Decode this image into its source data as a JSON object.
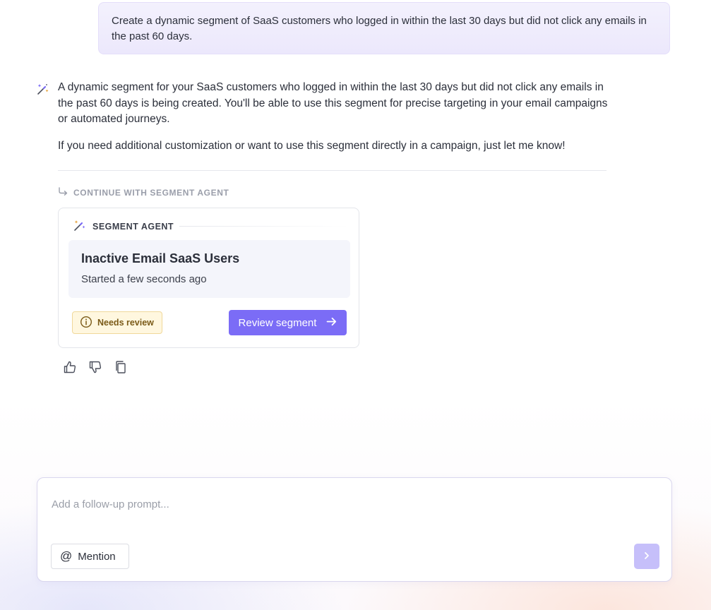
{
  "user_message": "Create a dynamic segment of SaaS customers who logged in within the last 30 days but did not click any emails in the past 60 days.",
  "assistant": {
    "icon": "magic-wand-sparkle-icon",
    "paragraphs": [
      "A dynamic segment for your SaaS customers who logged in within the last 30 days but did not click any emails in the past 60 days is being created. You'll be able to use this segment for precise targeting in your email campaigns or automated journeys.",
      "If you need additional customization or want to use this segment directly in a campaign, just let me know!"
    ]
  },
  "continue_label": "CONTINUE WITH SEGMENT AGENT",
  "agent_card": {
    "header": "SEGMENT AGENT",
    "title": "Inactive Email SaaS Users",
    "subtitle": "Started a few seconds ago",
    "badge": "Needs review",
    "action": "Review segment"
  },
  "feedback": {
    "icons": [
      "thumbs-up-icon",
      "thumbs-down-icon",
      "copy-icon"
    ]
  },
  "composer": {
    "placeholder": "Add a follow-up prompt...",
    "mention_label": "Mention"
  },
  "colors": {
    "accent": "#7b6cf6",
    "send_disabled": "#c6bffa",
    "badge_bg": "#fff7df",
    "badge_text": "#7a5a17",
    "user_bubble": "#efecfc"
  }
}
